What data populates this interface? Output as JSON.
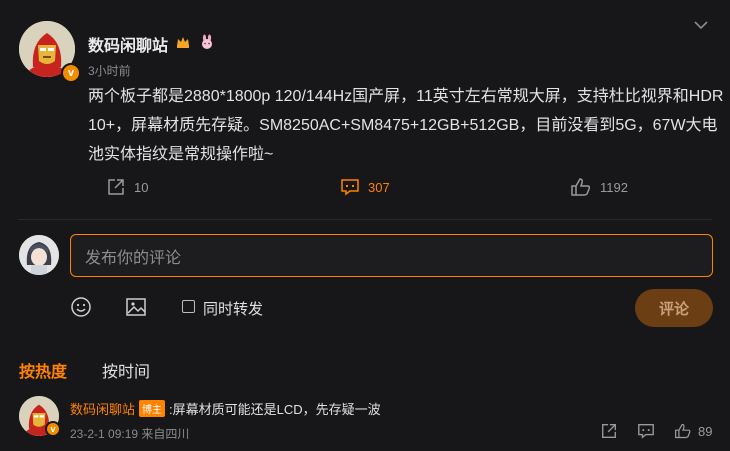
{
  "post": {
    "author": "数码闲聊站",
    "time": "3小时前",
    "content": "两个板子都是2880*1800p 120/144Hz国产屏，11英寸左右常规大屏，支持杜比视界和HDR10+，屏幕材质先存疑。SM8250AC+SM8475+12GB+512GB，目前没看到5G，67W大电池实体指纹是常规操作啦~",
    "verified_badge": "v",
    "reposts": "10",
    "comments": "307",
    "likes": "1192"
  },
  "composer": {
    "placeholder": "发布你的评论",
    "repost_label": "同时转发",
    "submit_label": "评论"
  },
  "sort_tabs": {
    "hot": "按热度",
    "time": "按时间"
  },
  "reply": {
    "author": "数码闲聊站",
    "tag": "博主",
    "text": ":屏幕材质可能还是LCD，先存疑一波",
    "meta": "23-2-1 09:19 来自四川",
    "likes": "89",
    "verified_badge": "v"
  },
  "colors": {
    "accent": "#ff8200",
    "background": "#17171a"
  }
}
